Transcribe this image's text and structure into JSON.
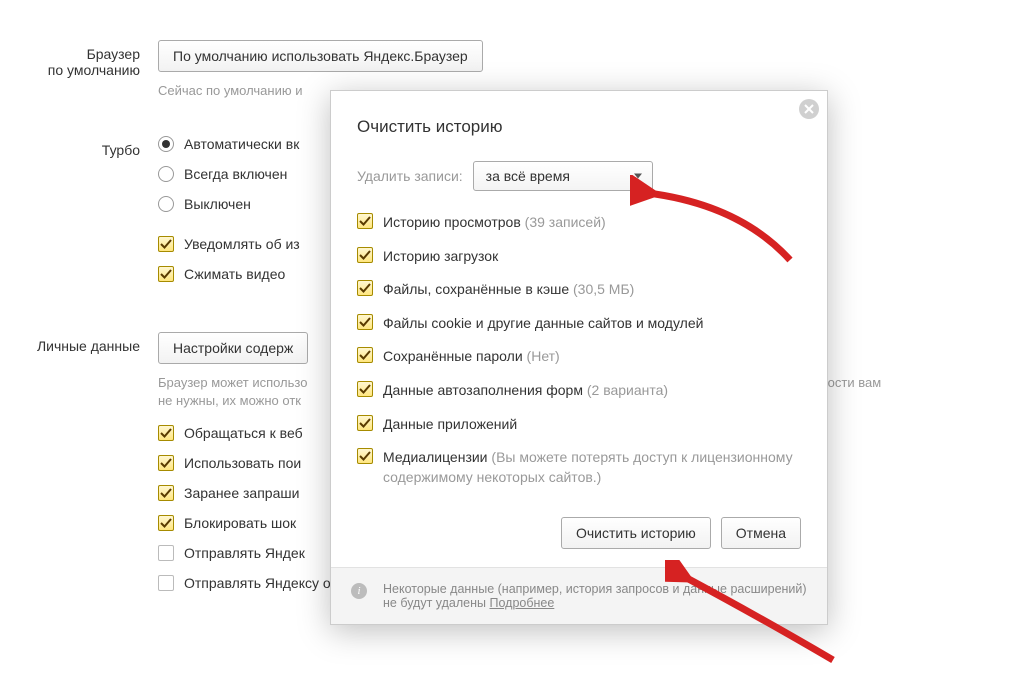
{
  "settings": {
    "default_browser": {
      "label": "Браузер\nпо умолчанию",
      "button": "По умолчанию использовать Яндекс.Браузер",
      "hint": "Сейчас по умолчанию и"
    },
    "turbo": {
      "label": "Турбо",
      "radios": [
        {
          "label": "Автоматически вк",
          "checked": true
        },
        {
          "label": "Всегда включен",
          "checked": false
        },
        {
          "label": "Выключен",
          "checked": false
        }
      ],
      "checks": [
        {
          "label": "Уведомлять об из",
          "checked": true
        },
        {
          "label": "Сжимать видео",
          "checked": true
        }
      ]
    },
    "personal": {
      "label": "Личные данные",
      "button": "Настройки содерж",
      "hint_line1": "Браузер может использо",
      "hint_line2": "не нужны, их можно отк",
      "hint_tail": "ожности вам",
      "checks": [
        {
          "label": "Обращаться к веб",
          "checked": true
        },
        {
          "label": "Использовать пои",
          "checked": true
        },
        {
          "label": "Заранее запраши",
          "checked": true
        },
        {
          "label": "Блокировать шок",
          "checked": true
        },
        {
          "label": "Отправлять Яндек",
          "checked": false
        },
        {
          "label": "Отправлять Яндексу отчёты о сбоях",
          "checked": false
        }
      ]
    }
  },
  "modal": {
    "title": "Очистить историю",
    "period_label": "Удалить записи:",
    "period_value": "за всё время",
    "items": [
      {
        "label": "Историю просмотров",
        "suffix": "(39 записей)",
        "checked": true
      },
      {
        "label": "Историю загрузок",
        "suffix": "",
        "checked": true
      },
      {
        "label": "Файлы, сохранённые в кэше",
        "suffix": "(30,5 МБ)",
        "checked": true
      },
      {
        "label": "Файлы cookie и другие данные сайтов и модулей",
        "suffix": "",
        "checked": true
      },
      {
        "label": "Сохранённые пароли",
        "suffix": "(Нет)",
        "checked": true
      },
      {
        "label": "Данные автозаполнения форм",
        "suffix": "(2 варианта)",
        "checked": true
      },
      {
        "label": "Данные приложений",
        "suffix": "",
        "checked": true
      },
      {
        "label": "Медиалицензии",
        "suffix": "(Вы можете потерять доступ к лицензионному содержимому некоторых сайтов.)",
        "checked": true
      }
    ],
    "actions": {
      "clear": "Очистить историю",
      "cancel": "Отмена"
    },
    "footer": {
      "text": "Некоторые данные (например, история запросов и данные расширений) не будут удалены ",
      "link": "Подробнее"
    }
  }
}
